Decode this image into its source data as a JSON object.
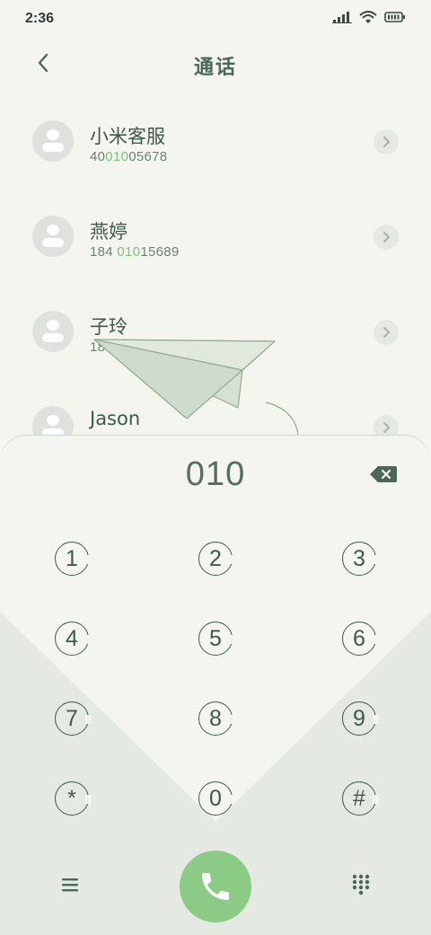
{
  "status_bar": {
    "time": "2:36",
    "icons": [
      "signal-icon",
      "wifi-icon",
      "battery-icon"
    ]
  },
  "header": {
    "title": "通话",
    "back_icon": "chevron-left-icon"
  },
  "contacts": [
    {
      "name": "小米客服",
      "number_prefix": "40",
      "number_match": "010",
      "number_suffix": "05678"
    },
    {
      "name": "燕婷",
      "number_prefix": "184 ",
      "number_match": "010",
      "number_suffix": "15689"
    },
    {
      "name": "子玲",
      "number_prefix": "184 ",
      "number_match": "010",
      "number_suffix": "1 5678"
    },
    {
      "name": "Jason",
      "number_prefix": "",
      "number_match": "",
      "number_suffix": ""
    }
  ],
  "dialer": {
    "input": "010",
    "keys": [
      "1",
      "2",
      "3",
      "4",
      "5",
      "6",
      "7",
      "8",
      "9",
      "*",
      "0",
      "#"
    ]
  },
  "colors": {
    "background": "#f4f5ef",
    "accent": "#3f5a4b",
    "highlight": "#7cc27b",
    "call_button": "#8bcb86"
  }
}
